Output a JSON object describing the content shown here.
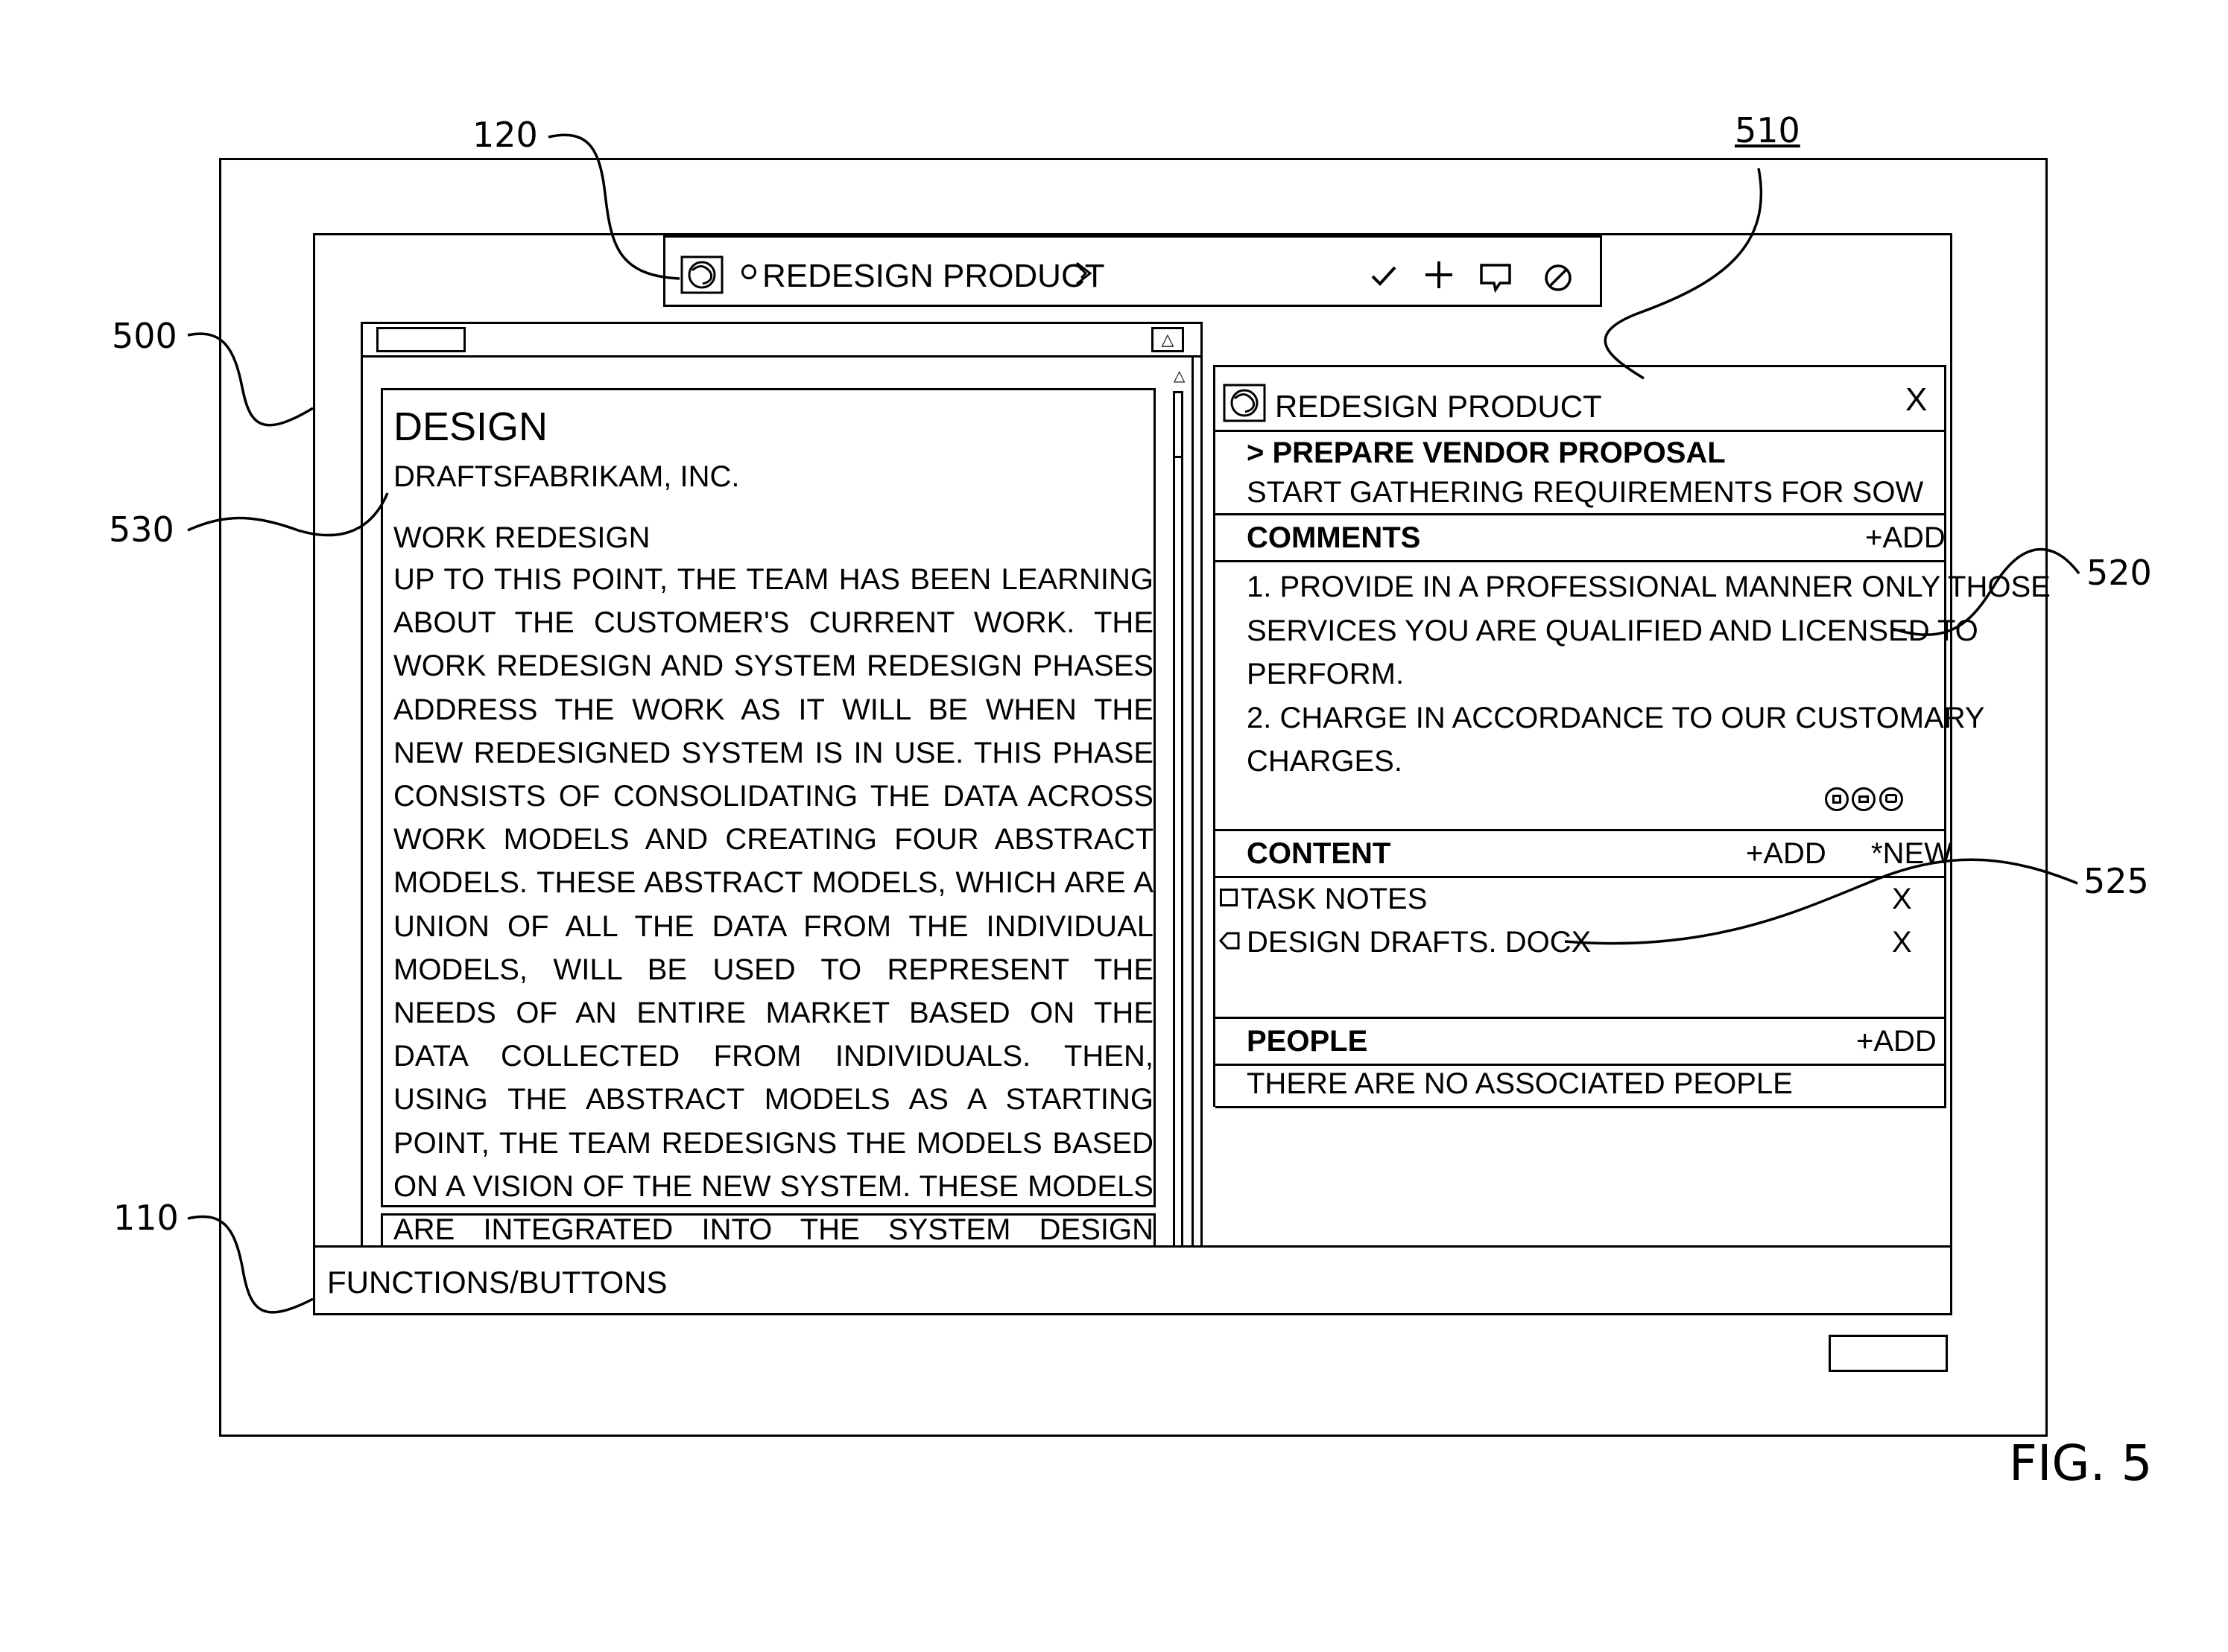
{
  "refs": {
    "r120": "120",
    "r510": "510",
    "r500": "500",
    "r530": "530",
    "r520": "520",
    "r525": "525",
    "r110": "110"
  },
  "figure_label": "FIG. 5",
  "toolbar": {
    "app_icon": "swirl-logo-icon",
    "title": "REDESIGN PRODUCT",
    "actions": [
      "check-icon",
      "plus-icon",
      "comment-icon",
      "cancel-icon"
    ]
  },
  "document": {
    "title": "DESIGN",
    "company": "DRAFTSFABRIKAM, INC.",
    "section": "WORK REDESIGN",
    "body": "UP TO THIS POINT, THE TEAM HAS BEEN LEARNING ABOUT THE CUSTOMER'S CURRENT WORK. THE WORK REDESIGN AND SYSTEM REDESIGN PHASES ADDRESS THE WORK AS IT WILL BE WHEN THE NEW REDESIGNED SYSTEM IS IN USE. THIS PHASE CONSISTS OF CONSOLIDATING THE DATA ACROSS WORK MODELS AND CREATING FOUR ABSTRACT MODELS. THESE ABSTRACT MODELS, WHICH ARE A UNION OF ALL THE DATA FROM THE INDIVIDUAL MODELS, WILL BE USED TO REPRESENT THE NEEDS OF AN ENTIRE MARKET BASED ON THE DATA COLLECTED FROM INDIVIDUALS. THEN, USING THE ABSTRACT MODELS AS A STARTING POINT, THE TEAM REDESIGNS THE MODELS BASED ON A VISION OF THE NEW SYSTEM. THESE MODELS ARE INTEGRATED INTO THE SYSTEM DESIGN DURING THE FINAL STEP OF THE PROCESS."
  },
  "task_panel": {
    "title": "REDESIGN PRODUCT",
    "close": "X",
    "task": "> PREPARE VENDOR PROPOSAL",
    "task_desc": "START GATHERING REQUIREMENTS FOR SOW",
    "comments": {
      "header": "COMMENTS",
      "add": "+ADD",
      "lines": [
        "1. PROVIDE IN A PROFESSIONAL MANNER ONLY THOSE",
        "SERVICES YOU ARE QUALIFIED AND LICENSED TO",
        "PERFORM.",
        "2. CHARGE IN ACCORDANCE TO OUR CUSTOMARY",
        "CHARGES."
      ]
    },
    "content": {
      "header": "CONTENT",
      "add": "+ADD",
      "new": "*NEW",
      "items": [
        {
          "icon": "note-icon",
          "label": "TASK NOTES",
          "remove": "X"
        },
        {
          "icon": "tag-icon",
          "label": "DESIGN DRAFTS. DOCX",
          "remove": "X"
        }
      ]
    },
    "people": {
      "header": "PEOPLE",
      "add": "+ADD",
      "empty": "THERE ARE NO ASSOCIATED PEOPLE"
    }
  },
  "bottom_bar": {
    "label": "FUNCTIONS/BUTTONS"
  }
}
